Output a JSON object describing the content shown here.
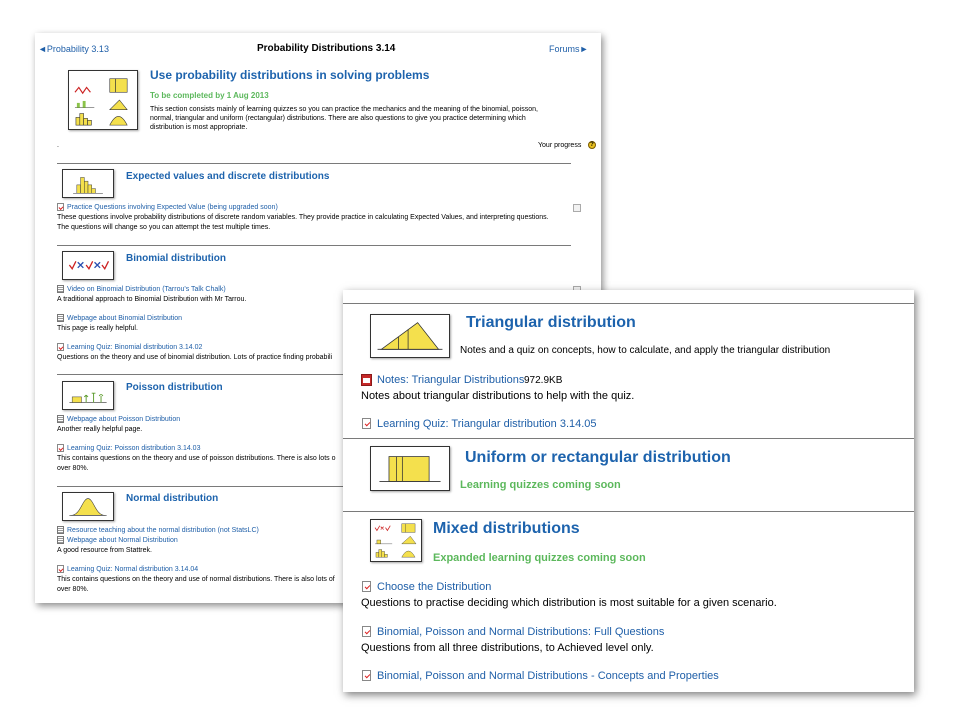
{
  "back": {
    "nav": {
      "prev": "◄Probability 3.13",
      "title": "Probability Distributions 3.14",
      "next": "Forums►"
    },
    "intro": {
      "heading": "Use probability distributions in solving problems",
      "due": "To be completed by 1 Aug 2013",
      "desc1": "This section consists mainly of learning quizzes so you can practice the mechanics and the meaning of the binomial, poisson,",
      "desc2": "normal, triangular and uniform (rectangular) distributions. There are also questions to give you practice determining which",
      "desc3": "distribution is most appropriate.",
      "dot": ".",
      "progress": "Your progress",
      "help_mark": "?"
    },
    "expected": {
      "heading": "Expected values and discrete distributions",
      "link1": "Practice Questions involving Expected Value (being upgraded soon)",
      "text1": "These questions involve probability distributions of discrete random variables. They provide practice in calculating Expected Values, and interpreting questions.",
      "text2": "The questions will change so you can attempt the test multiple times."
    },
    "binomial": {
      "heading": "Binomial distribution",
      "link1": "Video on Binomial Distribution (Tarrou's Talk Chalk)",
      "text1": "A traditional approach to Binomial Distribution with Mr Tarrou.",
      "link2": "Webpage about Binomial Distribution",
      "text2": "This page is really helpful.",
      "link3": "Learning Quiz: Binomial distribution 3.14.02",
      "text3": "Questions on the theory and use of binomial distribution. Lots of practice finding probabili"
    },
    "poisson": {
      "heading": "Poisson distribution",
      "link1": "Webpage about Poisson Distribution",
      "text1": "Another really helpful page.",
      "link2": "Learning Quiz: Poisson distribution 3.14.03",
      "text2": "This contains questions on the theory and use of poisson distributions. There is also lots o",
      "text3": "over 80%."
    },
    "normal": {
      "heading": "Normal distribution",
      "link1": "Resource teaching about the normal distribution (not StatsLC)",
      "link2": "Webpage about Normal Distribution",
      "text1": "A good resource from Stattrek.",
      "link3": "Learning Quiz: Normal distribution 3.14.04",
      "text2": "This contains questions on the theory and use of normal distributions. There is also lots of",
      "text3": "over 80%."
    }
  },
  "front": {
    "triangular": {
      "heading": "Triangular distribution",
      "subtitle": "Notes and a quiz on concepts, how to calculate, and apply the triangular distribution",
      "notes_link": "Notes: Triangular Distributions",
      "notes_size": "972.9KB",
      "notes_text": "Notes about triangular distributions to help with the quiz.",
      "quiz_link": "Learning Quiz: Triangular distribution 3.14.05"
    },
    "uniform": {
      "heading": "Uniform or rectangular distribution",
      "coming": "Learning quizzes coming soon"
    },
    "mixed": {
      "heading": "Mixed distributions",
      "coming": "Expanded learning quizzes coming soon",
      "link1": "Choose the Distribution",
      "text1": "Questions to practise deciding which distribution is most suitable for a given scenario.",
      "link2": "Binomial, Poisson and Normal Distributions: Full Questions",
      "text2": "Questions from all three distributions, to Achieved level only.",
      "link3": "Binomial, Poisson and Normal Distributions - Concepts and Properties"
    }
  },
  "colors": {
    "link": "#1f5fa8",
    "heading": "#1d63ad",
    "coming_soon": "#5cb85c",
    "chart_fill": "#f4e04d"
  },
  "icons": [
    "quiz-icon",
    "page-icon",
    "pdf-icon",
    "help-icon",
    "checkbox"
  ]
}
